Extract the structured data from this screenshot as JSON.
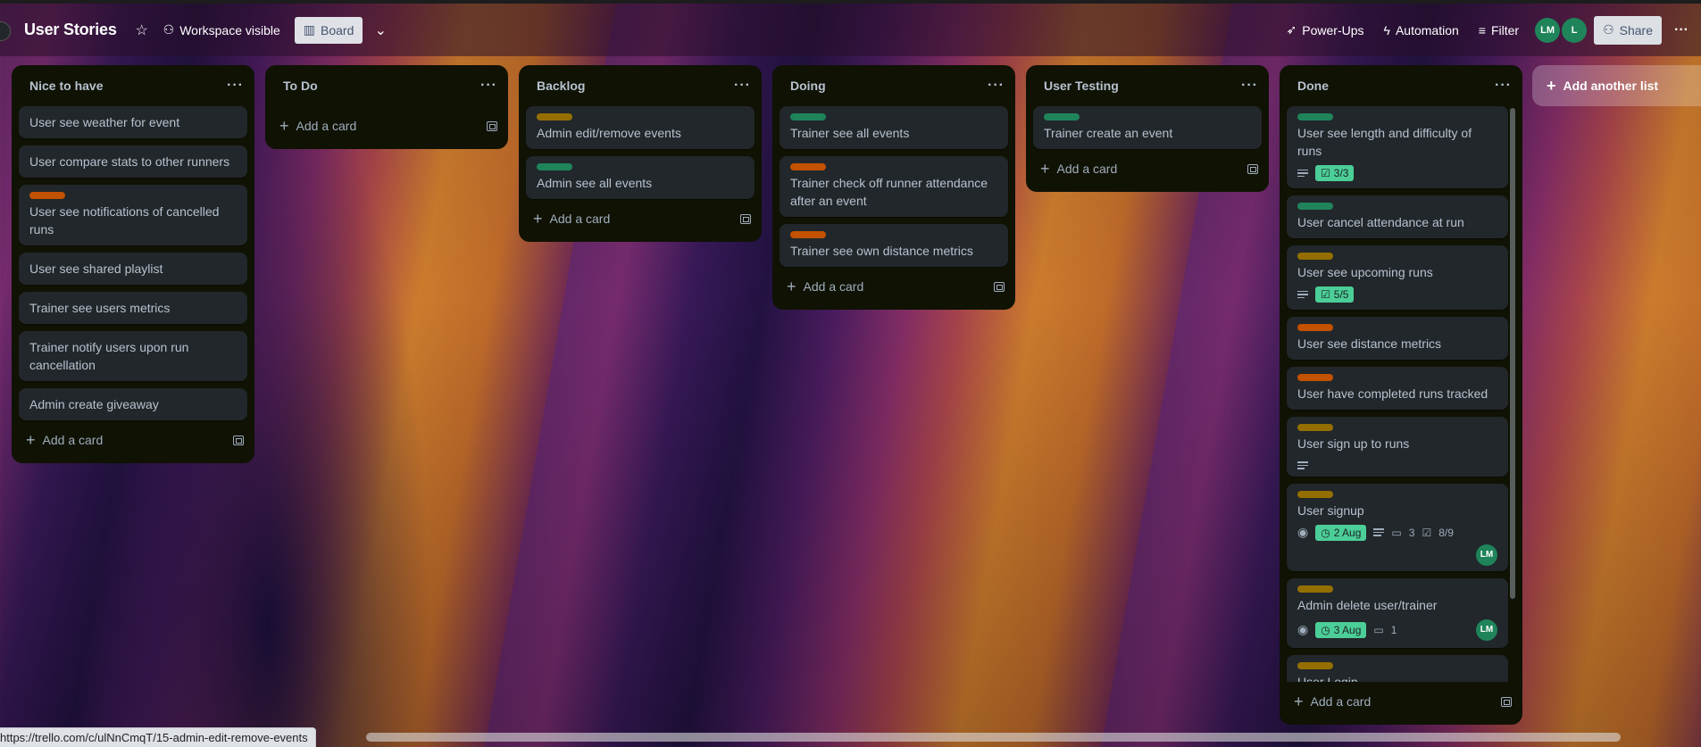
{
  "header": {
    "board_title": "User Stories",
    "visibility_label": "Workspace visible",
    "view_label": "Board",
    "powerups_label": "Power-Ups",
    "automation_label": "Automation",
    "filter_label": "Filter",
    "members": [
      {
        "initials": "LM",
        "color": "#1f845a"
      },
      {
        "initials": "L",
        "color": "#1f845a"
      }
    ],
    "share_label": "Share",
    "more_label": "···"
  },
  "lists": [
    {
      "title": "Nice to have",
      "cards": [
        {
          "title": "User see weather for event"
        },
        {
          "title": "User compare stats to other runners"
        },
        {
          "title": "User see notifications of cancelled runs",
          "label_color": "#c25100"
        },
        {
          "title": "User see shared playlist"
        },
        {
          "title": "Trainer see users metrics"
        },
        {
          "title": "Trainer notify users upon run cancellation"
        },
        {
          "title": "Admin create giveaway"
        }
      ]
    },
    {
      "title": "To Do",
      "cards": []
    },
    {
      "title": "Backlog",
      "cards": [
        {
          "title": "Admin edit/remove events",
          "label_color": "#946f00"
        },
        {
          "title": "Admin see all events",
          "label_color": "#1f845a"
        }
      ]
    },
    {
      "title": "Doing",
      "cards": [
        {
          "title": "Trainer see all events",
          "label_color": "#1f845a"
        },
        {
          "title": "Trainer check off runner attendance after an event",
          "label_color": "#c25100"
        },
        {
          "title": "Trainer see own distance metrics",
          "label_color": "#c25100"
        }
      ]
    },
    {
      "title": "User Testing",
      "cards": [
        {
          "title": "Trainer create an event",
          "label_color": "#1f845a"
        }
      ]
    },
    {
      "title": "Done",
      "cards": [
        {
          "title": "User see length and difficulty of runs",
          "label_color": "#1f845a",
          "checklist": "3/3"
        },
        {
          "title": "User cancel attendance at run",
          "label_color": "#1f845a"
        },
        {
          "title": "User see upcoming runs",
          "label_color": "#946f00",
          "checklist": "5/5"
        },
        {
          "title": "User see distance metrics",
          "label_color": "#c25100"
        },
        {
          "title": "User have completed runs tracked",
          "label_color": "#c25100"
        },
        {
          "title": "User sign up to runs",
          "label_color": "#946f00"
        },
        {
          "title": "User signup",
          "label_color": "#946f00",
          "due": "2 Aug",
          "comments": "3",
          "checklist": "8/9",
          "member": "LM"
        },
        {
          "title": "Admin delete user/trainer",
          "label_color": "#946f00",
          "due": "3 Aug",
          "comments": "1",
          "member": "LM"
        },
        {
          "title": "User Login",
          "label_color": "#946f00"
        }
      ]
    }
  ],
  "add_card_label": "Add a card",
  "list_menu_label": "···",
  "add_list_label": "Add another list",
  "status_url": "https://trello.com/c/ulNnCmqT/15-admin-edit-remove-events"
}
